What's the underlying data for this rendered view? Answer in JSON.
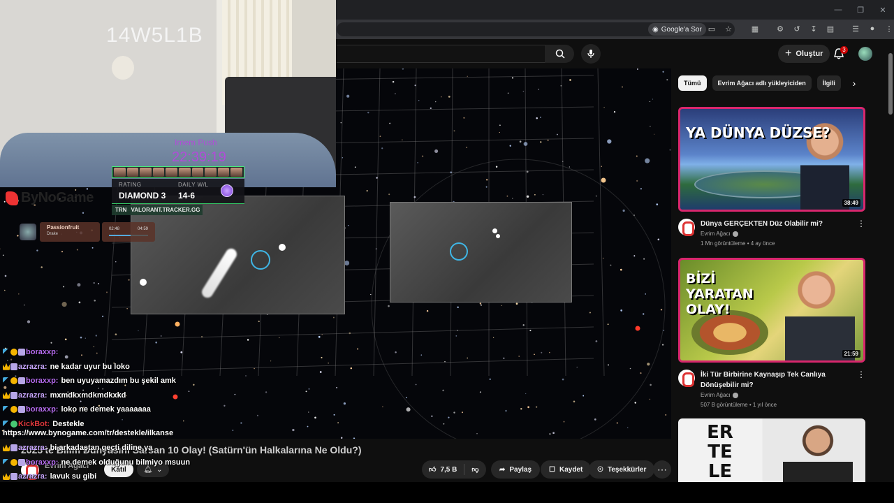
{
  "browser": {
    "ask_chip_label": "Google'a Sor",
    "toolbar_icons": [
      "google-lens-icon",
      "cast-icon",
      "star-icon",
      "extensions-icon",
      "puzzle-icon",
      "history-icon",
      "download-icon",
      "translate-icon",
      "tab-search-icon",
      "profile-icon",
      "menu-icon"
    ]
  },
  "youtube": {
    "create_label": "Oluştur",
    "notification_count": "3",
    "video_title": "2025'te Bilim Dünyasını Sarsan 10 Olay! (Satürn'ün Halkalarına Ne Oldu?)",
    "channel_name": "Evrim Ağacı",
    "join_label": "Katıl",
    "likes": "7,5 B",
    "share_label": "Paylaş",
    "save_label": "Kaydet",
    "thanks_label": "Teşekkürler"
  },
  "stream_overlay": {
    "cam_label": "14W5L1B",
    "timer_title": "Imem Push",
    "timer_value": "22:39:19",
    "rating_label": "RATING",
    "rating_value": "DIAMOND 3",
    "daily_label": "DAILY W/L",
    "daily_value": "14-6",
    "tracker_badge": "TRN",
    "tracker_label": "VALORANT.TRACKER.GG",
    "brand": "ByNoGame",
    "music": {
      "title": "Passionfruit",
      "artist": "Drake",
      "current": "02:48",
      "total": "04:59",
      "progress": 0.56
    }
  },
  "chat": {
    "messages": [
      {
        "badges": [
          "sword",
          "coin",
          "pic"
        ],
        "user": "boraxxp:",
        "color": "#b56cf0",
        "text": ""
      },
      {
        "badges": [
          "crown",
          "pic"
        ],
        "user": "azrazra:",
        "color": "#c9a8ff",
        "text": "ne kadar uyur bu loko"
      },
      {
        "badges": [
          "sword",
          "coin",
          "pic"
        ],
        "user": "boraxxp:",
        "color": "#b56cf0",
        "text": "ben uyuyamazdım bu şekil amk"
      },
      {
        "badges": [
          "crown",
          "pic"
        ],
        "user": "azrazra:",
        "color": "#c9a8ff",
        "text": "mxmdkxmdkmdkxkd"
      },
      {
        "badges": [
          "sword",
          "coin",
          "pic"
        ],
        "user": "boraxxp:",
        "color": "#b56cf0",
        "text": "loko ne demek yaaaaaaa"
      },
      {
        "badges": [
          "sword",
          "bot"
        ],
        "user": "KickBot:",
        "color": "#e0383e",
        "text": "Destekle"
      }
    ],
    "link": "https://www.bynogame.com/tr/destekle/ilkanse",
    "lower_messages": [
      {
        "badges": [
          "crown",
          "pic"
        ],
        "user": "azrazra:",
        "color": "#c9a8ff",
        "text": "bi arkadaştan geçti diline ya"
      },
      {
        "badges": [
          "sword",
          "coin",
          "pic"
        ],
        "user": "boraxxp:",
        "color": "#b56cf0",
        "text": "ne demek olduğunu bilmiyo msuun"
      },
      {
        "badges": [
          "crown",
          "pic"
        ],
        "user": "azrazra:",
        "color": "#c9a8ff",
        "text": "lavuk su gibi"
      }
    ]
  },
  "sidebar": {
    "chips": [
      {
        "label": "Tümü",
        "active": true
      },
      {
        "label": "Evrim Ağacı adlı yükleyiciden",
        "active": false
      },
      {
        "label": "İlgili",
        "active": false
      }
    ],
    "cards": [
      {
        "thumb_text": "YA DÜNYA DÜZSE?",
        "duration": "38:49",
        "title": "Dünya GERÇEKTEN Düz Olabilir mi?",
        "channel": "Evrim Ağacı",
        "stats": "1 Mn görüntüleme • 4 ay önce"
      },
      {
        "thumb_text": "BİZİ YARATAN OLAY!",
        "duration": "21:59",
        "title": "İki Tür Birbirine Kaynaşıp Tek Canlıya Dönüşebilir mi?",
        "channel": "Evrim Ağacı",
        "stats": "507 B görüntüleme • 1 yıl önce"
      },
      {
        "thumb_text": "ER TE LE",
        "duration": "",
        "title": "",
        "channel": "",
        "stats": ""
      }
    ]
  },
  "colors": {
    "accent_red": "#cc0000",
    "ring_blue": "#3fb6e6",
    "thumb_border": "#d8276d",
    "timer_purple": "#b04dd8"
  }
}
